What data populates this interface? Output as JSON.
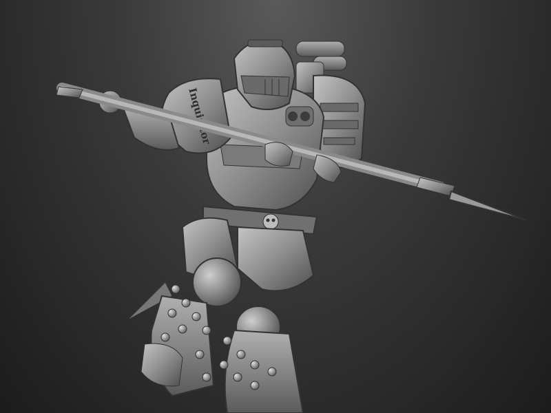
{
  "scene": {
    "subject_icon": "armored-warrior-spear-sculpt-icon",
    "shoulder_engraving": "Inquisitor",
    "colors": {
      "background_top": "#5a5a5a",
      "background_bottom": "#1c1c1c",
      "material_light": "#b8b8b8",
      "material_mid": "#8a8a8a",
      "material_dark": "#4a4a4a"
    }
  }
}
